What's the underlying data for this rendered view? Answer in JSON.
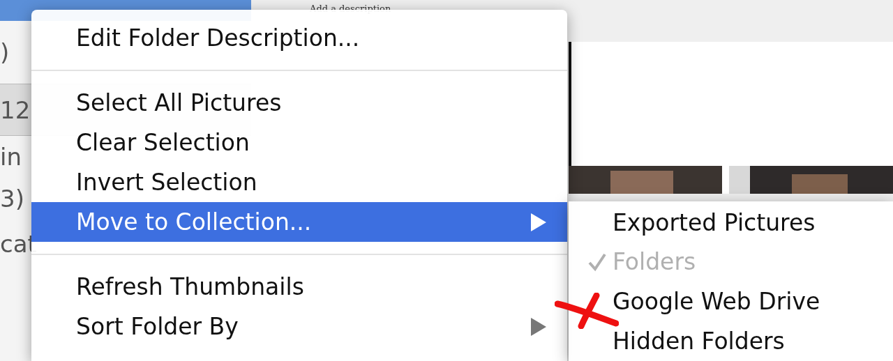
{
  "background": {
    "description": "Add a description",
    "sidebar_fragments": [
      ")",
      "12",
      "in",
      "3)",
      "cat"
    ]
  },
  "context_menu": {
    "items": [
      {
        "kind": "item",
        "label": "Edit Folder Description...",
        "selected": false,
        "submenu": false
      },
      {
        "kind": "separator"
      },
      {
        "kind": "item",
        "label": "Select All Pictures",
        "selected": false,
        "submenu": false
      },
      {
        "kind": "item",
        "label": "Clear Selection",
        "selected": false,
        "submenu": false
      },
      {
        "kind": "item",
        "label": "Invert Selection",
        "selected": false,
        "submenu": false
      },
      {
        "kind": "item",
        "label": "Move to Collection...",
        "selected": true,
        "submenu": true
      },
      {
        "kind": "separator"
      },
      {
        "kind": "item",
        "label": "Refresh Thumbnails",
        "selected": false,
        "submenu": false
      },
      {
        "kind": "item",
        "label": "Sort Folder By",
        "selected": false,
        "submenu": true
      }
    ]
  },
  "submenu": {
    "items": [
      {
        "label": "Exported Pictures",
        "checked": false,
        "disabled": false
      },
      {
        "label": "Folders",
        "checked": true,
        "disabled": true
      },
      {
        "label": "Google Web Drive",
        "checked": false,
        "disabled": false
      },
      {
        "label": "Hidden Folders",
        "checked": false,
        "disabled": false
      }
    ]
  }
}
